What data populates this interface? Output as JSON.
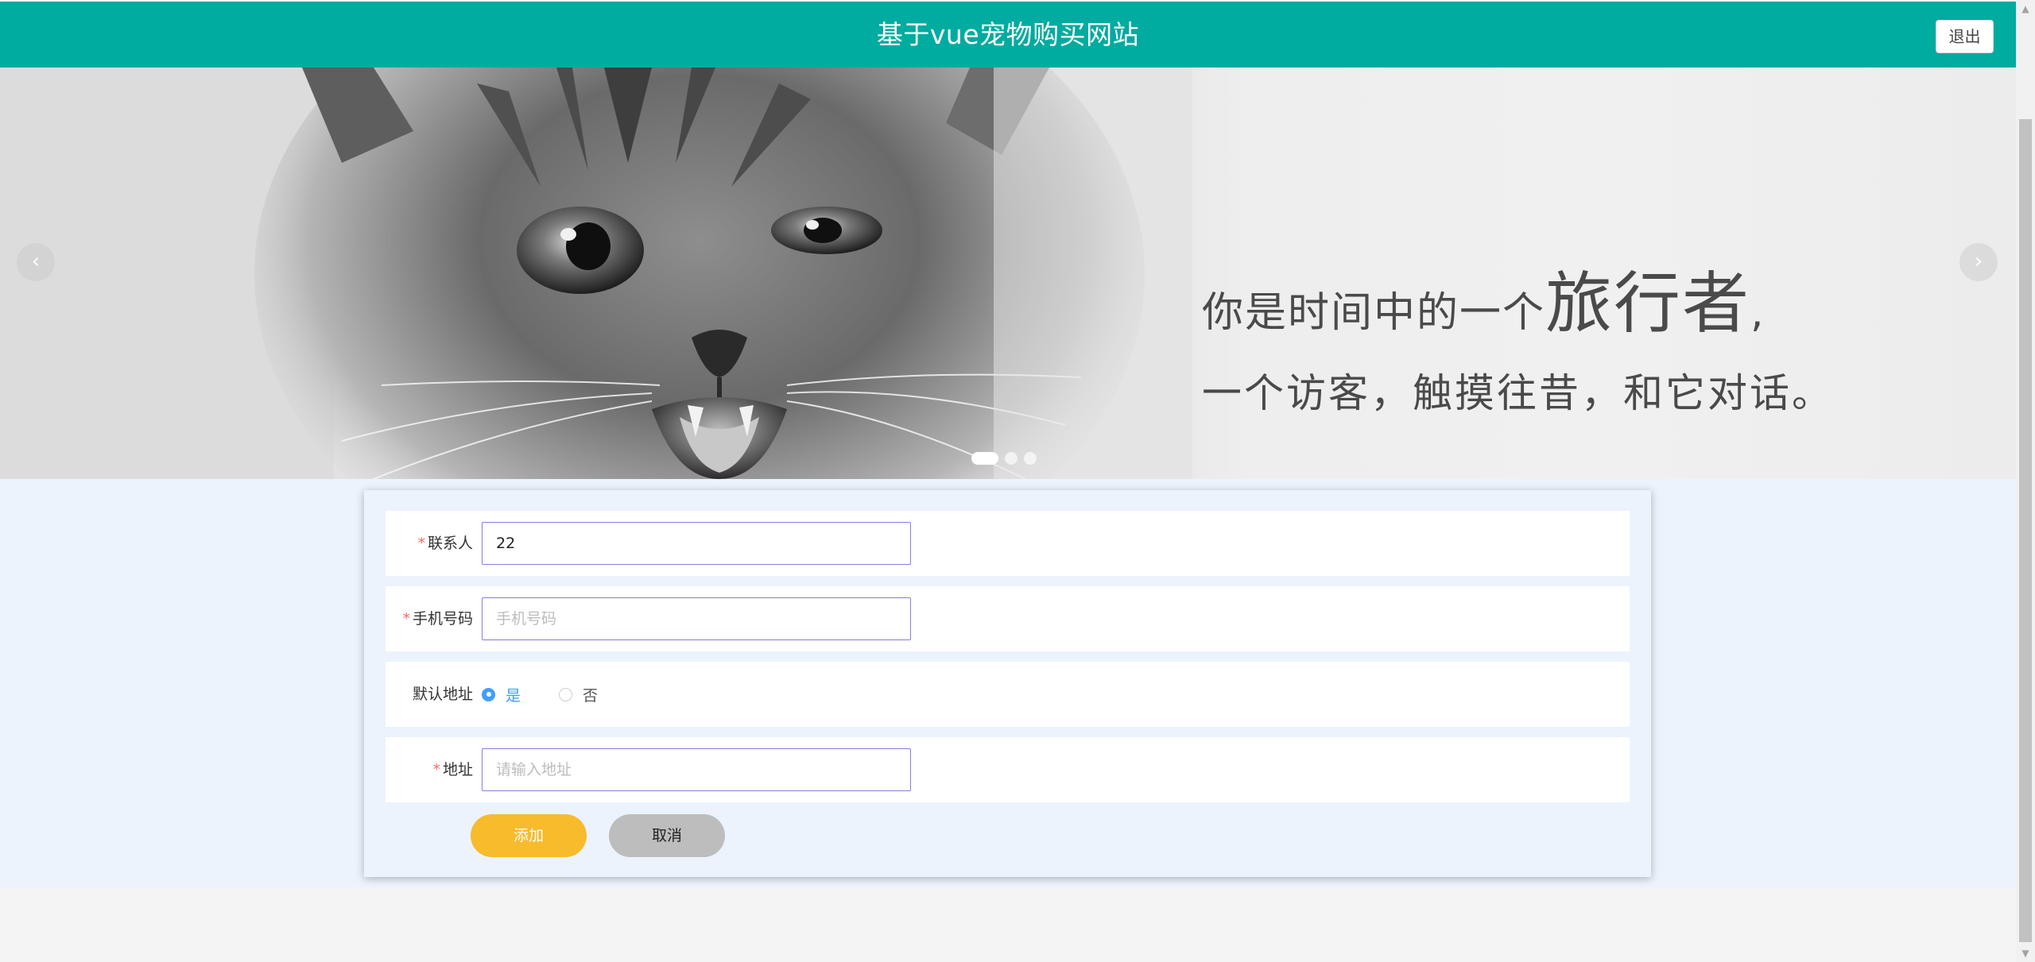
{
  "header": {
    "title": "基于vue宠物购买网站",
    "logout_label": "退出"
  },
  "banner": {
    "line1_prefix": "你是时间中的一个",
    "line1_big": "旅行者",
    "line1_suffix": ",",
    "line2": "一个访客，触摸往昔，和它对话。",
    "prev_icon": "‹",
    "next_icon": "›",
    "slide_count": 3,
    "active_slide": 1
  },
  "form": {
    "required_mark": "*",
    "contact": {
      "label": "联系人",
      "value": "22",
      "placeholder": ""
    },
    "phone": {
      "label": "手机号码",
      "value": "",
      "placeholder": "手机号码"
    },
    "default_address": {
      "label": "默认地址",
      "options": [
        "是",
        "否"
      ],
      "selected": "是"
    },
    "address": {
      "label": "地址",
      "value": "",
      "placeholder": "请输入地址"
    },
    "add_label": "添加",
    "cancel_label": "取消"
  },
  "colors": {
    "header": "#00ab9f",
    "add_button": "#f7bb2b",
    "cancel_button": "#bdbdbd",
    "radio_active": "#409eff",
    "content_bg": "#ecf3fd",
    "required": "#f56c6c"
  }
}
